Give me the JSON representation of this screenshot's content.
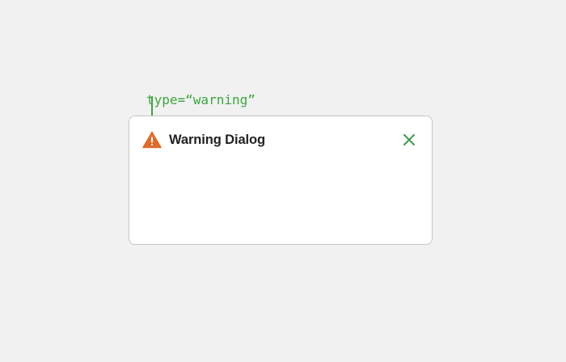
{
  "annotation": {
    "code_label": "type=“warning”",
    "variant_label": "warning"
  },
  "dialog": {
    "title": "Warning Dialog",
    "icon": "warning-icon",
    "close_icon": "close-icon"
  },
  "colors": {
    "code_green": "#3aa83d",
    "variant_orange": "#d4630a",
    "warning_icon": "#e06c2a",
    "close_icon": "#3a9a4a",
    "background": "#f1f1f1"
  }
}
